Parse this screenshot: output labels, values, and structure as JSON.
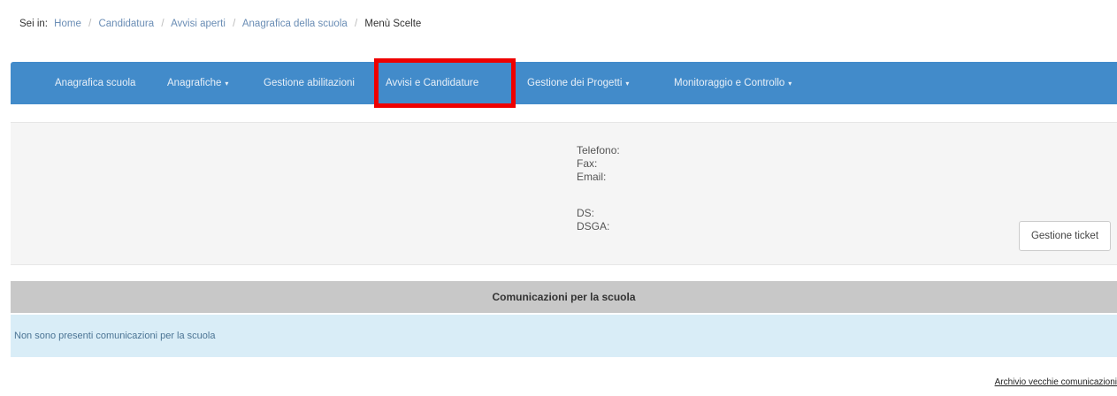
{
  "breadcrumb": {
    "prefix": "Sei in:",
    "items": [
      "Home",
      "Candidatura",
      "Avvisi aperti",
      "Anagrafica della scuola"
    ],
    "current": "Menù Scelte"
  },
  "nav": {
    "items": [
      {
        "label": "Anagrafica scuola",
        "dropdown": false
      },
      {
        "label": "Anagrafiche",
        "dropdown": true
      },
      {
        "label": "Gestione abilitazioni",
        "dropdown": false
      },
      {
        "label": "Avvisi e Candidature",
        "dropdown": false,
        "highlighted": true
      },
      {
        "label": "Gestione dei Progetti",
        "dropdown": true
      },
      {
        "label": "Monitoraggio e Controllo",
        "dropdown": true
      }
    ],
    "caret": "▾"
  },
  "info": {
    "telefono": "Telefono:",
    "fax": "Fax:",
    "email": "Email:",
    "ds": "DS:",
    "dsga": "DSGA:"
  },
  "ticket_button": "Gestione ticket",
  "communications": {
    "header": "Comunicazioni per la scuola",
    "empty_message": "Non sono presenti comunicazioni per la scuola",
    "archive_link": "Archivio vecchie comunicazioni"
  },
  "colors": {
    "navbar": "#428bca",
    "highlight": "#ee0000",
    "comm_header": "#c8c8c8",
    "comm_body": "#d9edf7"
  }
}
